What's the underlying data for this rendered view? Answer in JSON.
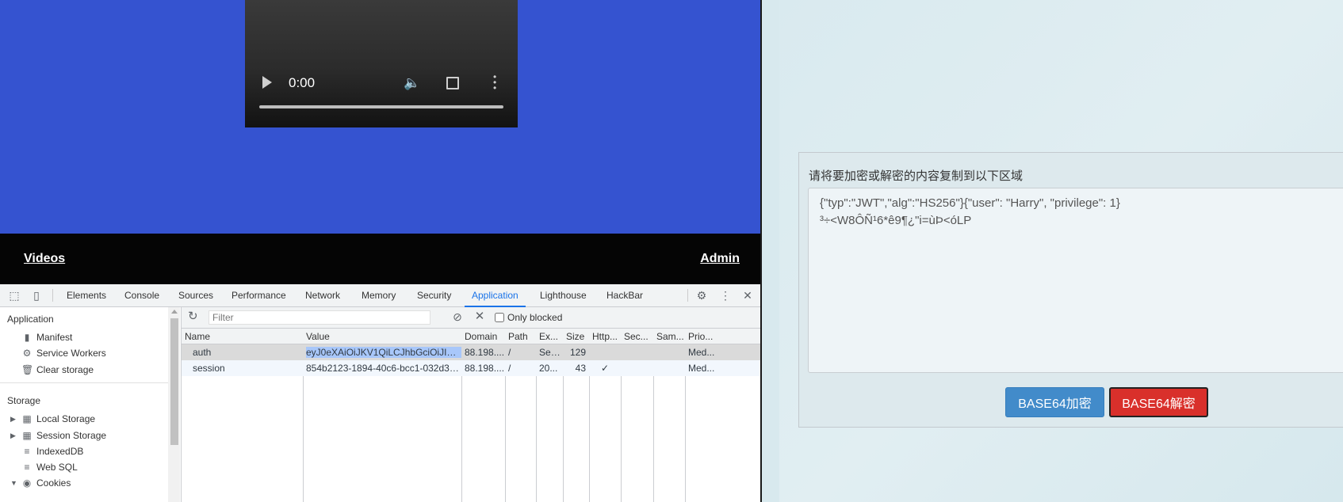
{
  "video": {
    "time": "0:00"
  },
  "footer": {
    "videos": "Videos",
    "admin": "Admin"
  },
  "devtools": {
    "tabs": [
      "Elements",
      "Console",
      "Sources",
      "Performance",
      "Network",
      "Memory",
      "Security",
      "Application",
      "Lighthouse",
      "HackBar"
    ],
    "active_tab": "Application",
    "sidebar": {
      "application_header": "Application",
      "application_items": [
        "Manifest",
        "Service Workers",
        "Clear storage"
      ],
      "storage_header": "Storage",
      "storage_items": [
        "Local Storage",
        "Session Storage",
        "IndexedDB",
        "Web SQL",
        "Cookies"
      ]
    },
    "cookies": {
      "filter_placeholder": "Filter",
      "only_blocked": "Only blocked",
      "headers": [
        "Name",
        "Value",
        "Domain",
        "Path",
        "Ex...",
        "Size",
        "Http...",
        "Sec...",
        "Sam...",
        "Prio..."
      ],
      "rows": [
        {
          "name": "auth",
          "value": "eyJ0eXAiOiJKV1QiLCJhbGciOiJIUzI1...",
          "domain": "88.198....",
          "path": "/",
          "expires": "Ses...",
          "size": "129",
          "http": "",
          "secure": "",
          "samesite": "",
          "priority": "Med..."
        },
        {
          "name": "session",
          "value": "854b2123-1894-40c6-bcc1-032d3a...",
          "domain": "88.198....",
          "path": "/",
          "expires": "20...",
          "size": "43",
          "http": "✓",
          "secure": "",
          "samesite": "",
          "priority": "Med..."
        }
      ]
    }
  },
  "base64_tool": {
    "label": "请将要加密或解密的内容复制到以下区域",
    "content": "{\"typ\":\"JWT\",\"alg\":\"HS256\"}{\"user\": \"Harry\", \"privilege\": 1}\n³÷<W8ÔÑ¹6*ê9¶¿\"i=ùÞ<óLP",
    "encode_label": "BASE64加密",
    "decode_label": "BASE64解密"
  },
  "colors": {
    "page_blue": "#3553d0",
    "footer_black": "#050505",
    "devtools_accent": "#1a73e8",
    "encode_button": "#428bca",
    "decode_button": "#d9302b",
    "right_bg": "#d8e9ee"
  }
}
